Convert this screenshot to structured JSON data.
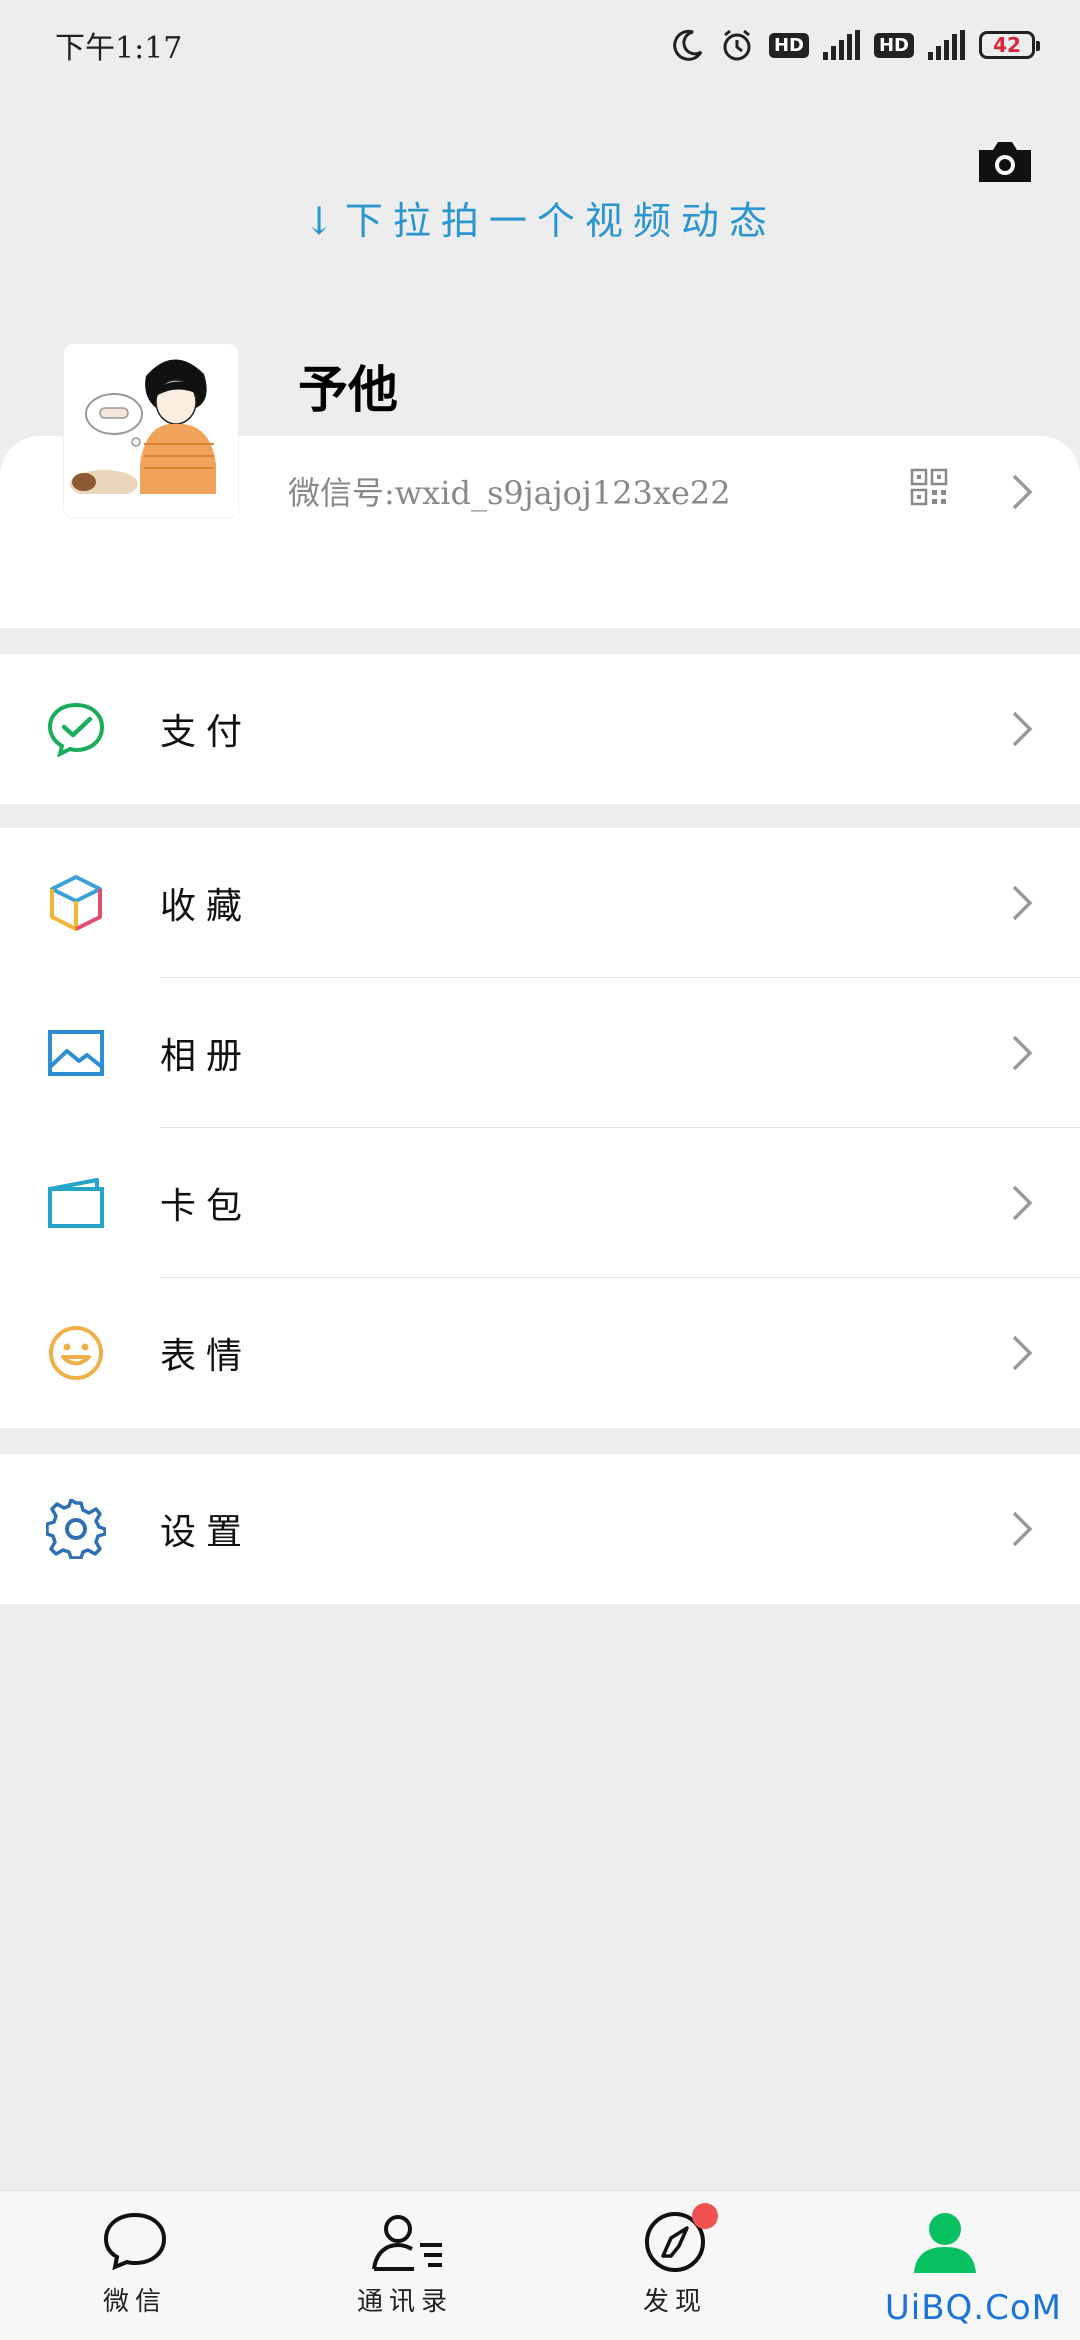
{
  "status_bar": {
    "time": "下午1:17",
    "hd1": "HD",
    "hd2": "HD",
    "battery": "42"
  },
  "pull_hint": "↓下拉拍一个视频动态",
  "profile": {
    "nickname": "予他",
    "wxid": "微信号:wxid_s9jajoj123xe22"
  },
  "menu": {
    "pay": {
      "label": "支付",
      "icon": "wechat-pay-icon"
    },
    "favorites": {
      "label": "收藏",
      "icon": "cube-icon"
    },
    "album": {
      "label": "相册",
      "icon": "image-icon"
    },
    "cards": {
      "label": "卡包",
      "icon": "card-icon"
    },
    "stickers": {
      "label": "表情",
      "icon": "smiley-icon"
    },
    "settings": {
      "label": "设置",
      "icon": "gear-icon"
    }
  },
  "nav": {
    "chats": "微信",
    "contacts": "通讯录",
    "discover": "发现",
    "me_active_color": "#07c160"
  },
  "watermark": "UiBQ.CoM",
  "colors": {
    "accent_blue": "#2a96cf",
    "wechat_green": "#07c160",
    "badge_red": "#f05252"
  }
}
